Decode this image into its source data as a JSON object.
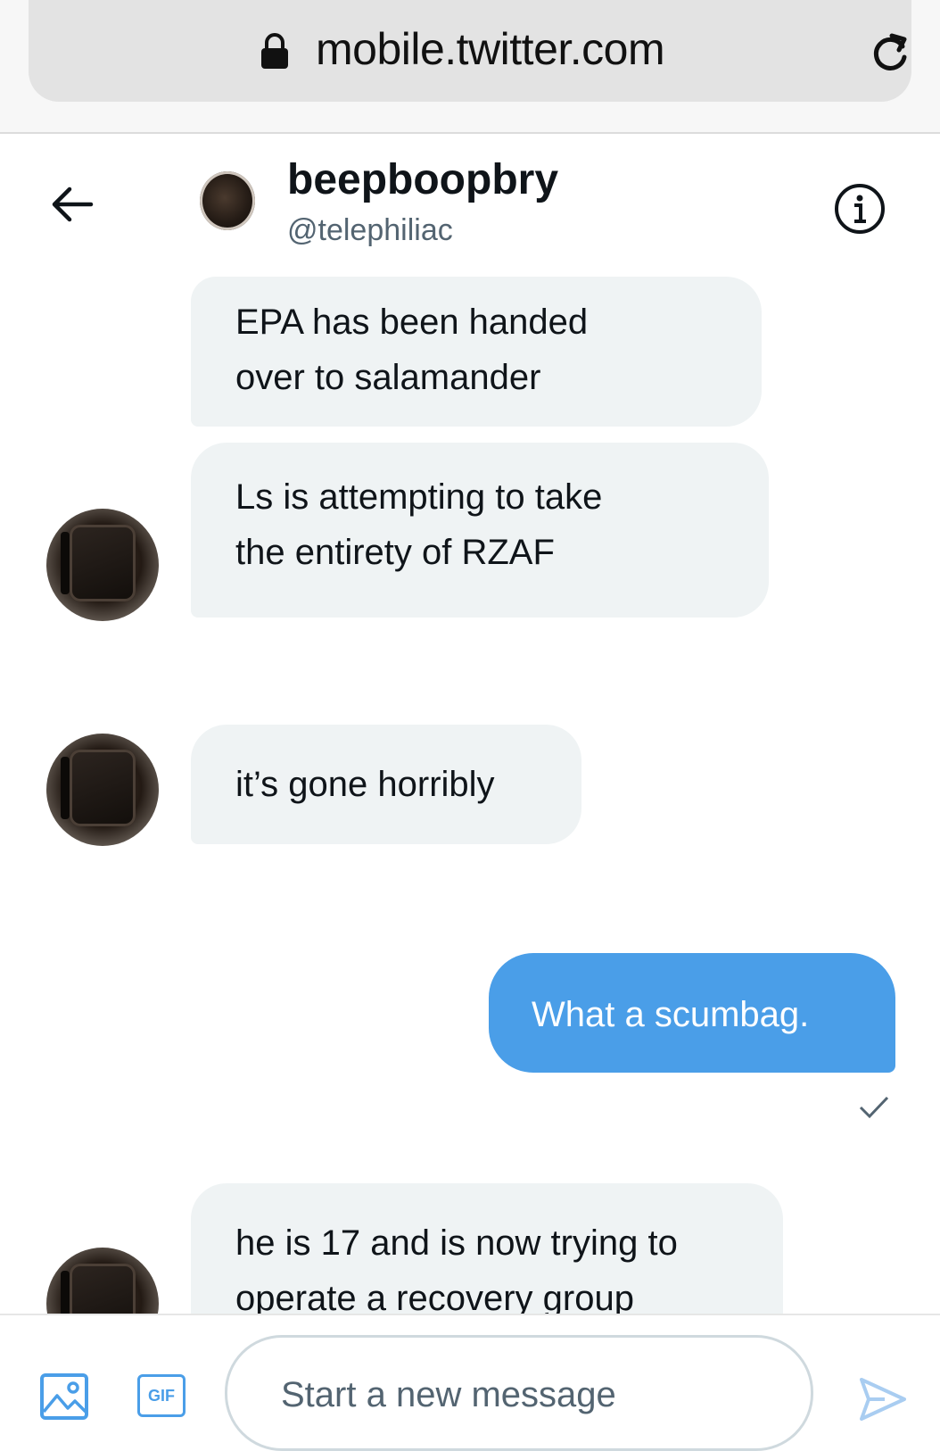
{
  "browser": {
    "url": "mobile.twitter.com",
    "lock_icon": "lock-icon",
    "reload_icon": "reload-icon"
  },
  "header": {
    "back_icon": "arrow-left-icon",
    "name": "beepboopbry",
    "handle": "@telephiliac",
    "info_icon": "info-icon"
  },
  "messages": [
    {
      "direction": "received",
      "lines": [
        "EPA has been handed",
        "over to salamander"
      ]
    },
    {
      "direction": "received",
      "lines": [
        "Ls is attempting to take",
        "the entirety of RZAF"
      ]
    },
    {
      "direction": "received",
      "lines": [
        "it’s gone horribly"
      ]
    },
    {
      "direction": "sent",
      "text": "What a scumbag.",
      "status_icon": "checkmark-icon"
    },
    {
      "direction": "received",
      "lines": [
        "he is 17 and is now trying to",
        "operate a recovery group"
      ]
    }
  ],
  "composer": {
    "media_icon": "image-icon",
    "gif_label": "GIF",
    "placeholder": "Start a new message",
    "send_icon": "send-icon"
  },
  "colors": {
    "accent": "#4a9ee8",
    "received_bubble": "#eff3f4",
    "secondary_text": "#536471"
  }
}
